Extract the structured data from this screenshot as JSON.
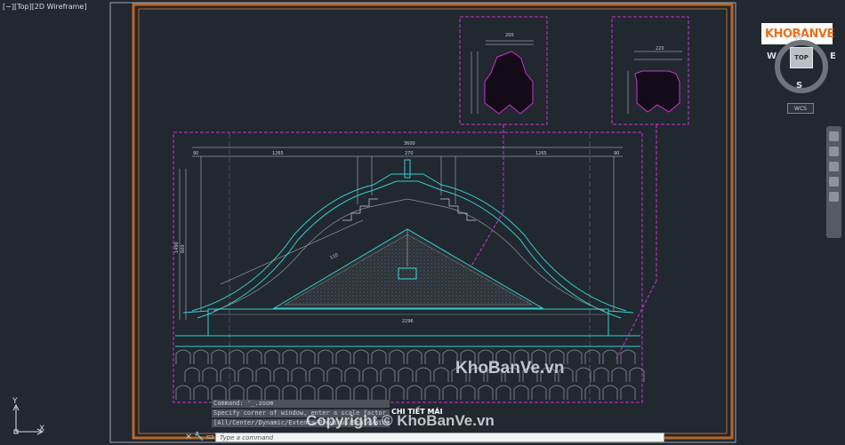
{
  "viewport": {
    "label": "[−][Top][2D Wireframe]"
  },
  "navcube": {
    "top_face": "TOP",
    "north": "N",
    "south": "S",
    "east": "E",
    "west": "W",
    "wcs_label": "WCS"
  },
  "logo": {
    "text": "KHOBANVE"
  },
  "drawing": {
    "title": "CHI TIẾT MÁI",
    "dims_top": [
      "90",
      "1265",
      "75",
      "70",
      "185",
      "270",
      "185",
      "70",
      "75",
      "1265",
      "90"
    ],
    "total_width": "3600",
    "base_width": "2296",
    "left_dims": [
      "60",
      "75",
      "75",
      "130",
      "1490",
      "600",
      "75",
      "250"
    ],
    "slope_label": "110",
    "peak_label": "425",
    "detail1_dims": [
      "200",
      "15",
      "40",
      "60",
      "40",
      "15",
      "15"
    ],
    "detail2_dims": [
      "220",
      "20",
      "20",
      "120",
      "20",
      "20"
    ]
  },
  "command": {
    "history": [
      "Command: '_.zoom",
      "Specify corner of window, enter a scale factor (nX or nXP), or",
      "[All/Center/Dynamic/Extents/Previous/Scale/Window/Object] <real time>:"
    ],
    "placeholder": "Type a command",
    "close_icon": "×",
    "settings_icon": "wrench"
  },
  "watermark": {
    "center": "KhoBanVe.vn",
    "bottom": "Copyright © KhoBanVe.vn"
  },
  "ucs": {
    "x": "X",
    "y": "Y"
  },
  "colors": {
    "background": "#212830",
    "frame": "#b8672a",
    "cyan": "#35d0d0",
    "magenta": "#d030d0",
    "lines": "#9aa3ad"
  }
}
